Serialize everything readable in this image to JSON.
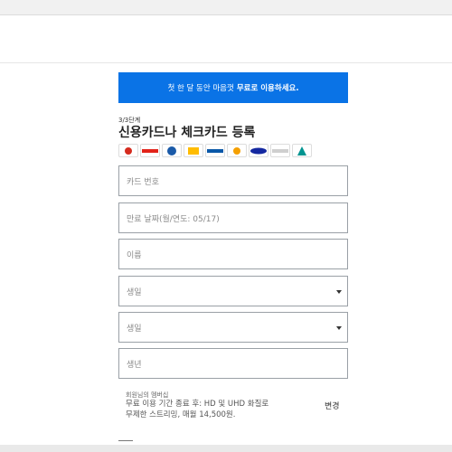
{
  "banner": {
    "text_prefix": "첫 한 달 동안 마음껏",
    "text_bold": "무료로 이용하세요."
  },
  "form": {
    "step": "3/3단계",
    "title": "신용카드나 체크카드 등록",
    "card_logos": [
      "hyundai",
      "LOTTE",
      "woori",
      "KB",
      "KEB",
      "NH",
      "SAMSUNG",
      "card",
      "hana"
    ],
    "fields": {
      "card_number": "카드 번호",
      "expiry": "만료 날짜(월/연도: 05/17)",
      "name": "이름",
      "birth_1": "생일",
      "birth_2": "생일",
      "birth_year": "생년"
    },
    "membership": {
      "label": "회원님의 멤버십",
      "desc": "무료 이용 기간 종료 후: HD 및 UHD 화질로 무제한 스트리밍, 매월 14,500원.",
      "change": "변경"
    }
  },
  "colors": {
    "accent": "#0a73e6",
    "field_border": "#9aa0a6"
  }
}
